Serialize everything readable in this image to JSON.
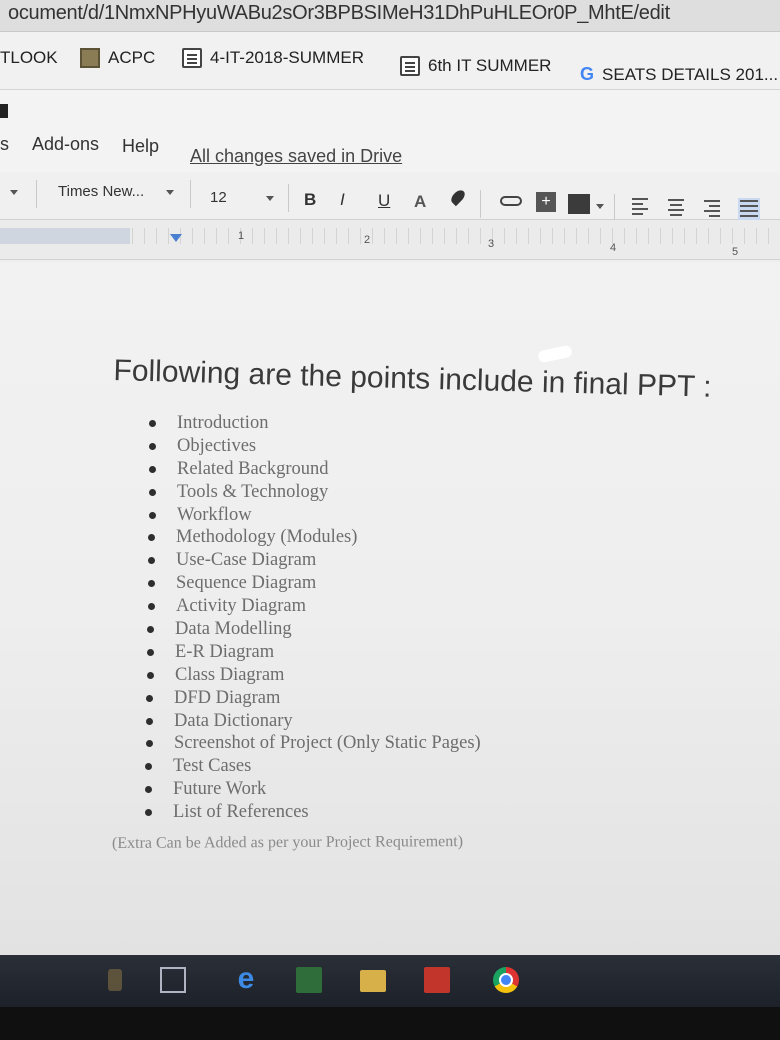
{
  "browser": {
    "url": "ocument/d/1NmxNPHyuWABu2sOr3BPBSIMeH31DhPuHLEOr0P_MhtE/edit"
  },
  "bookmarks": [
    {
      "label": "TLOOK",
      "icon": "none"
    },
    {
      "label": "ACPC",
      "icon": "acpc-icon"
    },
    {
      "label": "4-IT-2018-SUMMER",
      "icon": "doc-icon"
    },
    {
      "label": "6th IT SUMMER",
      "icon": "doc-icon"
    },
    {
      "label": "SEATS DETAILS 201...",
      "icon": "google-icon"
    }
  ],
  "menu": {
    "items": [
      "s",
      "Add-ons",
      "Help"
    ],
    "saved_status": "All changes saved in Drive"
  },
  "toolbar": {
    "font": "Times New...",
    "font_size": "12",
    "bold": "B",
    "italic": "I",
    "underline": "U",
    "text_color": "A"
  },
  "ruler": {
    "marks": [
      "1",
      "2",
      "3",
      "4",
      "5"
    ]
  },
  "document": {
    "heading": "Following are the points include in final PPT :",
    "bullets": [
      "Introduction",
      "Objectives",
      "Related Background",
      "Tools & Technology",
      "Workflow",
      "Methodology (Modules)",
      "Use-Case Diagram",
      "Sequence Diagram",
      "Activity Diagram",
      "Data Modelling",
      "E-R Diagram",
      "Class Diagram",
      "DFD Diagram",
      "Data Dictionary",
      "Screenshot of Project (Only Static Pages)",
      "Test Cases",
      "Future Work",
      "List of References"
    ],
    "note": "(Extra Can be Added as per your Project Requirement)"
  },
  "taskbar": {
    "icons": [
      "lock-icon",
      "task-view-icon",
      "edge-icon",
      "excel-icon",
      "file-explorer-icon",
      "acrobat-icon",
      "chrome-icon"
    ]
  },
  "colors": {
    "screen_bg": "#eeeeee",
    "taskbar": "#1d2129",
    "link": "#444444",
    "accent_blue": "#4a7fd1"
  }
}
